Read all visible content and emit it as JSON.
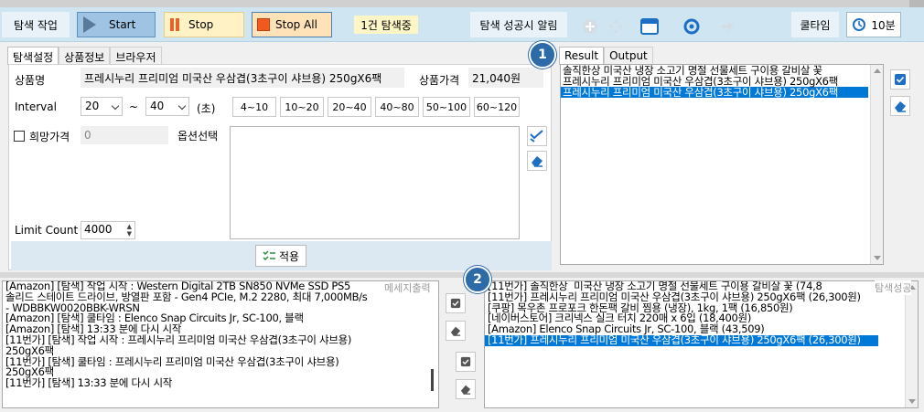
{
  "toolbar": {
    "search_task_label": "탐색 작업",
    "start_label": "Start",
    "stop_label": "Stop",
    "stop_all_label": "Stop All",
    "search_count": "1건 탐색중",
    "success_alert_label": "탐색 성공시 알림",
    "cooltime_label": "쿨타임",
    "cooltime_value": "10분"
  },
  "left_tabs": [
    "탐색설정",
    "상품정보",
    "브라우저"
  ],
  "form": {
    "product_name_label": "상품명",
    "product_name_value": "프레시누리 프리미엄 미국산 우삼겹(3초구이 샤브용) 250gX6팩",
    "product_price_label": "상품가격",
    "product_price_value": "21,040원",
    "interval_label": "Interval",
    "interval_from": "20",
    "interval_tilde": "~",
    "interval_to": "40",
    "interval_unit": "(초)",
    "range_buttons": [
      "4~10",
      "10~20",
      "20~40",
      "40~80",
      "50~100",
      "60~120"
    ],
    "desired_price_label": "희망가격",
    "desired_price_value": "0",
    "option_select_label": "옵션선택",
    "limit_count_label": "Limit Count",
    "limit_count_value": "4000",
    "apply_label": "적용"
  },
  "right_tabs": [
    "Result",
    "Output"
  ],
  "result_list": [
    "솔직한상  미국산 냉장 소고기 명절 선물세트 구이용 갈비살 꽃",
    "프레시누리 프리미엄 미국산 우삼겹(3초구이 샤브용) 250gX6팩",
    "프레시누리 프리미엄 미국산 우삼겹(3초구이 샤브용) 250gX6팩"
  ],
  "badges": [
    "1",
    "2"
  ],
  "message_output_label": "메세지출력",
  "search_success_label": "탐색성공",
  "message_log": [
    "[Amazon] [탐색] 작업 시작 : Western Digital 2TB SN850 NVMe SSD PS5",
    "솔리드 스테이트 드라이브, 방열판 포함 - Gen4 PCIe, M.2 2280, 최대 7,000MB/s",
    "- WDBBKW0020BBK-WRSN",
    "[Amazon] [탐색] 쿨타임 : Elenco Snap Circuits Jr, SC-100, 블랙",
    "[Amazon] [탐색] 13:33 분에 다시 시작",
    "[11번가] [탐색] 작업 시작 : 프레시누리 프리미엄 미국산 우삼겹(3초구이 샤브용)",
    "250gX6팩",
    "[11번가] [탐색] 쿨타임 : 프레시누리 프리미엄 미국산 우삼겹(3초구이 샤브용)",
    "250gX6팩",
    "[11번가] [탐색] 13:33 분에 다시 시작"
  ],
  "success_log": [
    "[11번가] 솔직한상  미국산 냉장 소고기 명절 선물세트 구이용 갈비살 꽃 (74,8",
    "[11번가] 프레시누리 프리미엄 미국산 우삼겹(3초구이 샤브용) 250gX6팩 (26,300원)",
    "[쿠팡] 목우촌 프로포크 한돈팩 갈비 찜용 (냉장), 1kg, 1팩 (16,850원)",
    "[네이버스토어] 크리넥스 실크 터치 220매 x 6입 (18,400원)",
    "[Amazon] Elenco Snap Circuits Jr, SC-100, 블랙 (43,509)",
    "[11번가] 프레시누리 프리미엄 미국산 우삼겹(3초구이 샤브용) 250gX6팩 (26,300원)"
  ],
  "colors": {
    "toolbar_bg": "#cfe6f2",
    "selection": "#0078d7",
    "badge": "#2d6aa8"
  }
}
